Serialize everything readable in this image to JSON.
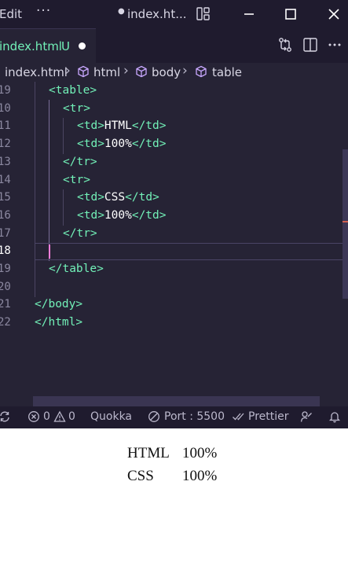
{
  "titlebar": {
    "menu_edit": "Edit",
    "menu_more": "···",
    "title_modified_dot": "●",
    "title": "index.ht..."
  },
  "tab": {
    "label": "index.html",
    "status": "U"
  },
  "breadcrumb": {
    "file": "index.html",
    "items": [
      "html",
      "body",
      "table"
    ]
  },
  "code": {
    "lines": [
      {
        "num": "19",
        "tokens": [
          {
            "t": "<table>",
            "c": "tag"
          }
        ]
      },
      {
        "num": "10",
        "tokens": [
          {
            "t": "<tr>",
            "c": "tag"
          }
        ]
      },
      {
        "num": "11",
        "tokens": [
          {
            "t": "<td>",
            "c": "tag"
          },
          {
            "t": "HTML",
            "c": "text"
          },
          {
            "t": "</td>",
            "c": "tag"
          }
        ]
      },
      {
        "num": "12",
        "tokens": [
          {
            "t": "<td>",
            "c": "tag"
          },
          {
            "t": "100%",
            "c": "text"
          },
          {
            "t": "</td>",
            "c": "tag"
          }
        ]
      },
      {
        "num": "13",
        "tokens": [
          {
            "t": "</tr>",
            "c": "tag"
          }
        ]
      },
      {
        "num": "14",
        "tokens": [
          {
            "t": "<tr>",
            "c": "tag"
          }
        ]
      },
      {
        "num": "15",
        "tokens": [
          {
            "t": "<td>",
            "c": "tag"
          },
          {
            "t": "CSS",
            "c": "text"
          },
          {
            "t": "</td>",
            "c": "tag"
          }
        ]
      },
      {
        "num": "16",
        "tokens": [
          {
            "t": "<td>",
            "c": "tag"
          },
          {
            "t": "100%",
            "c": "text"
          },
          {
            "t": "</td>",
            "c": "tag"
          }
        ]
      },
      {
        "num": "17",
        "tokens": [
          {
            "t": "</tr>",
            "c": "tag"
          }
        ]
      },
      {
        "num": "18",
        "tokens": [],
        "active": true
      },
      {
        "num": "19",
        "tokens": [
          {
            "t": "</table>",
            "c": "tag"
          }
        ]
      },
      {
        "num": "20",
        "tokens": []
      },
      {
        "num": "21",
        "tokens": [
          {
            "t": "</body>",
            "c": "tag"
          }
        ]
      },
      {
        "num": "22",
        "tokens": [
          {
            "t": "</html>",
            "c": "tag"
          }
        ]
      }
    ]
  },
  "statusbar": {
    "errors": "0",
    "warnings": "0",
    "quokka": "Quokka",
    "port": "Port : 5500",
    "prettier": "Prettier"
  },
  "preview": {
    "rows": [
      [
        "HTML",
        "100%"
      ],
      [
        "CSS",
        "100%"
      ]
    ]
  },
  "colors": {
    "editor_bg": "#262335",
    "chrome_bg": "#1f1b2e",
    "tag": "#72f1b8",
    "text": "#ffffff",
    "line_number": "#8b88a0",
    "cursor": "#ff7edb"
  }
}
